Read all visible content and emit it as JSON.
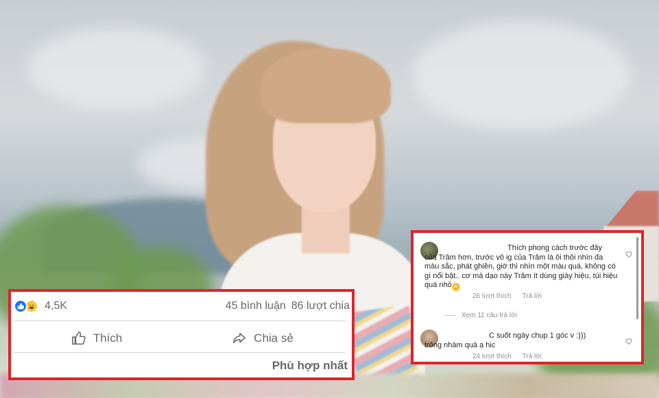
{
  "facebook": {
    "reaction_count": "4,5K",
    "reaction_icons": [
      "like-icon",
      "haha-icon"
    ],
    "comments_label": "45 bình luận",
    "shares_label": "86 lượt chia",
    "like_label": "Thích",
    "share_label": "Chia sẻ",
    "sort_label": "Phù hợp nhất",
    "accent_color": "#1877f2",
    "frame_color": "#e0232b"
  },
  "instagram": {
    "comments": [
      {
        "text_line1": "Thích phong cách trước đây",
        "text_rest": "của Trâm hơn, trước vô ig của Trâm là ôi thôi nhìn đa màu sắc, phát ghiền, giờ thì nhìn một màu quá, không có gì nổi bật.. cơ mà dạo này Trâm ít dùng giày hiệu, túi hiệu quá nhỏ",
        "likes": "26 lượt thích",
        "reply": "Trả lời"
      },
      {
        "text_line1": "C suốt ngày chụp 1 góc v :)))",
        "text_rest": "trông nhàm quá ạ hic",
        "likes": "24 lượt thích",
        "reply": "Trả lời"
      }
    ],
    "view_replies": "Xem 11 câu trả lời",
    "heart_icon": "heart-icon"
  }
}
